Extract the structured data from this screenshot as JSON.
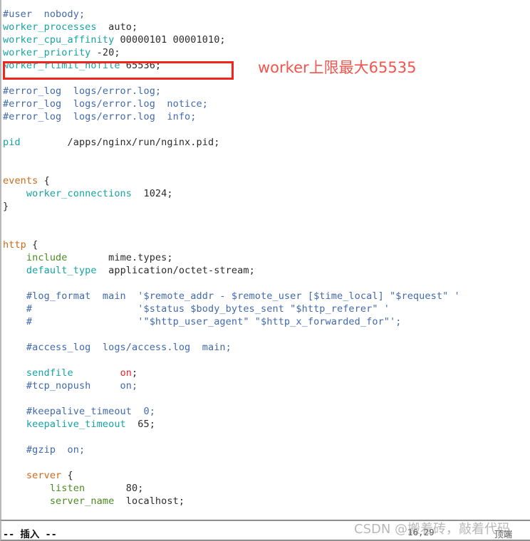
{
  "app": {
    "type": "terminal-text-editor",
    "editor": "vim",
    "filename_hint": "nginx.conf"
  },
  "colors": {
    "comment": "#4169ac",
    "directive_teal": "#16a3a3",
    "directive_green": "#4a8b20",
    "block_keyword": "#cf6a18",
    "plain": "#2b2b2b",
    "value_on": "#e8232a",
    "highlight_box": "#f1251c",
    "annotation": "#f5544d",
    "background": "#ffffff"
  },
  "annotation": {
    "text": "worker上限最大65535"
  },
  "statusbar": {
    "mode": "-- 插入 --",
    "cursor_position": "16,29",
    "file_position": "顶端"
  },
  "watermark": {
    "text": "CSDN @搬着砖，敲着代码"
  },
  "code": {
    "lines": [
      {
        "tokens": [
          {
            "t": "#user  nobody;",
            "c": "cmt"
          }
        ]
      },
      {
        "tokens": [
          {
            "t": "worker_processes",
            "c": "teal"
          },
          {
            "t": "  auto;",
            "c": "blk"
          }
        ]
      },
      {
        "tokens": [
          {
            "t": "worker_cpu_affinity",
            "c": "teal"
          },
          {
            "t": " 00000101 00001010;",
            "c": "blk"
          }
        ]
      },
      {
        "tokens": [
          {
            "t": "worker_priority",
            "c": "teal"
          },
          {
            "t": " -20;",
            "c": "blk"
          }
        ]
      },
      {
        "tokens": [
          {
            "t": "worker_rlimit_nofile",
            "c": "teal"
          },
          {
            "t": " 65536;",
            "c": "blk"
          }
        ]
      },
      {
        "tokens": []
      },
      {
        "tokens": [
          {
            "t": "#error_log  logs/error.log;",
            "c": "cmt"
          }
        ]
      },
      {
        "tokens": [
          {
            "t": "#error_log  logs/error.log  notice;",
            "c": "cmt"
          }
        ]
      },
      {
        "tokens": [
          {
            "t": "#error_log  logs/error.log  info;",
            "c": "cmt"
          }
        ]
      },
      {
        "tokens": []
      },
      {
        "tokens": [
          {
            "t": "pid",
            "c": "teal"
          },
          {
            "t": "        /apps/nginx/run/nginx.pid;",
            "c": "blk"
          }
        ]
      },
      {
        "tokens": []
      },
      {
        "tokens": []
      },
      {
        "tokens": [
          {
            "t": "events",
            "c": "org"
          },
          {
            "t": " {",
            "c": "blk"
          }
        ]
      },
      {
        "tokens": [
          {
            "t": "    worker_connections",
            "c": "teal"
          },
          {
            "t": "  1024;",
            "c": "blk"
          }
        ]
      },
      {
        "tokens": [
          {
            "t": "}",
            "c": "blk"
          }
        ]
      },
      {
        "tokens": []
      },
      {
        "tokens": []
      },
      {
        "tokens": [
          {
            "t": "http",
            "c": "org"
          },
          {
            "t": " {",
            "c": "blk"
          }
        ]
      },
      {
        "tokens": [
          {
            "t": "    include",
            "c": "grn"
          },
          {
            "t": "       mime.types;",
            "c": "blk"
          }
        ]
      },
      {
        "tokens": [
          {
            "t": "    default_type",
            "c": "teal"
          },
          {
            "t": "  application/octet-stream;",
            "c": "blk"
          }
        ]
      },
      {
        "tokens": []
      },
      {
        "tokens": [
          {
            "t": "    #log_format  main  '$remote_addr - $remote_user [$time_local] \"$request\" '",
            "c": "cmt"
          }
        ]
      },
      {
        "tokens": [
          {
            "t": "    #                  '$status $body_bytes_sent \"$http_referer\" '",
            "c": "cmt"
          }
        ]
      },
      {
        "tokens": [
          {
            "t": "    #                  '\"$http_user_agent\" \"$http_x_forwarded_for\"';",
            "c": "cmt"
          }
        ]
      },
      {
        "tokens": []
      },
      {
        "tokens": [
          {
            "t": "    #access_log  logs/access.log  main;",
            "c": "cmt"
          }
        ]
      },
      {
        "tokens": []
      },
      {
        "tokens": [
          {
            "t": "    sendfile",
            "c": "teal"
          },
          {
            "t": "        ",
            "c": "blk"
          },
          {
            "t": "on",
            "c": "red"
          },
          {
            "t": ";",
            "c": "blk"
          }
        ]
      },
      {
        "tokens": [
          {
            "t": "    #tcp_nopush",
            "c": "cmt"
          },
          {
            "t": "     on;",
            "c": "cmt"
          }
        ]
      },
      {
        "tokens": []
      },
      {
        "tokens": [
          {
            "t": "    #keepalive_timeout  0;",
            "c": "cmt"
          }
        ]
      },
      {
        "tokens": [
          {
            "t": "    keepalive_timeout",
            "c": "teal"
          },
          {
            "t": "  65;",
            "c": "blk"
          }
        ]
      },
      {
        "tokens": []
      },
      {
        "tokens": [
          {
            "t": "    #gzip  on;",
            "c": "cmt"
          }
        ]
      },
      {
        "tokens": []
      },
      {
        "tokens": [
          {
            "t": "    server",
            "c": "org"
          },
          {
            "t": " {",
            "c": "blk"
          }
        ]
      },
      {
        "tokens": [
          {
            "t": "        listen",
            "c": "grn"
          },
          {
            "t": "       80;",
            "c": "blk"
          }
        ]
      },
      {
        "tokens": [
          {
            "t": "        server_name",
            "c": "grn"
          },
          {
            "t": "  localhost;",
            "c": "blk"
          }
        ]
      }
    ]
  }
}
